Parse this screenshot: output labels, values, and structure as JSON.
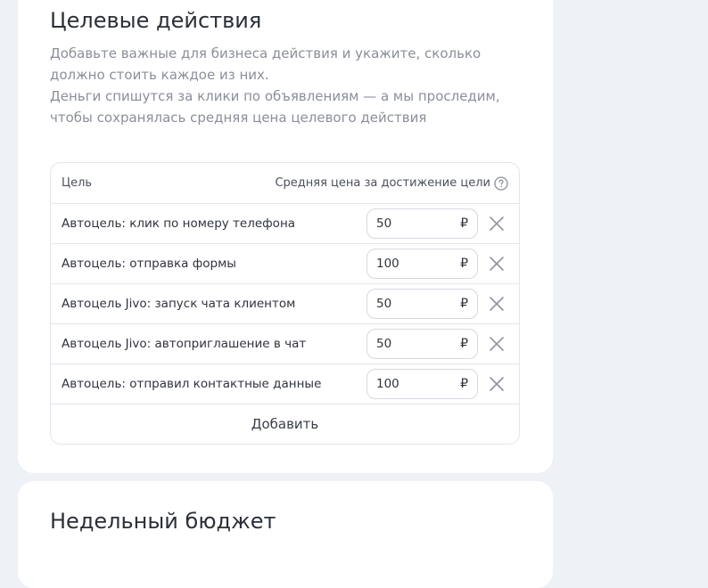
{
  "goals_section": {
    "title": "Целевые действия",
    "description_line1": "Добавьте важные для бизнеса действия и укажите, сколько должно стоить каждое из них.",
    "description_line2": "Деньги спишутся за клики по объявлениям — а мы проследим, чтобы сохранялась средняя цена целевого действия",
    "table": {
      "col_goal": "Цель",
      "col_price": "Средняя цена за достижение цели",
      "currency": "₽",
      "rows": [
        {
          "name": "Автоцель: клик по номеру телефона",
          "price": "50"
        },
        {
          "name": "Автоцель: отправка формы",
          "price": "100"
        },
        {
          "name": "Автоцель Jivo: запуск чата клиентом",
          "price": "50"
        },
        {
          "name": "Автоцель Jivo: автоприглашение в чат",
          "price": "50"
        },
        {
          "name": "Автоцель: отправил контактные данные",
          "price": "100"
        }
      ],
      "add_label": "Добавить"
    }
  },
  "budget_section": {
    "title": "Недельный бюджет"
  },
  "icons": {
    "help": "question-circle-icon",
    "remove": "close-icon"
  },
  "colors": {
    "page_bg": "#eef1f6",
    "card_bg": "#ffffff",
    "muted_text": "#8a8f9a",
    "border": "#e3e6ec"
  }
}
